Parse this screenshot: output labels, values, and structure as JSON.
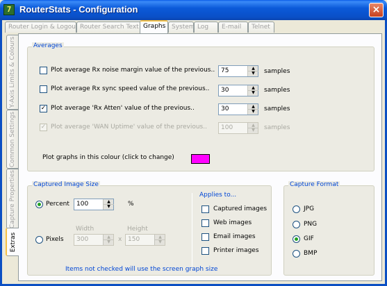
{
  "window": {
    "title": "RouterStats - Configuration",
    "close_glyph": "×",
    "app_icon_glyph": "7"
  },
  "top_tabs": [
    {
      "label": "Router Login & Logout"
    },
    {
      "label": "Router Search Text"
    },
    {
      "label": "Graphs"
    },
    {
      "label": "System"
    },
    {
      "label": "Log"
    },
    {
      "label": "E-mail"
    },
    {
      "label": "Telnet"
    }
  ],
  "side_tabs": [
    {
      "label": "Y-Axis Limits & Colours"
    },
    {
      "label": "Common Settings"
    },
    {
      "label": "Capture Properties"
    },
    {
      "label": "Extras"
    }
  ],
  "averages": {
    "title": "Averages",
    "samples_label": "samples",
    "rows": [
      {
        "label": "Plot average Rx noise margin value of the previous..",
        "checked": false,
        "enabled": true,
        "value": "75"
      },
      {
        "label": "Plot average Rx sync speed value of the previous..",
        "checked": false,
        "enabled": true,
        "value": "30"
      },
      {
        "label": "Plot average 'Rx Atten' value of the previous..",
        "checked": true,
        "enabled": true,
        "value": "30"
      },
      {
        "label": "Plot average 'WAN Uptime' value of the previous..",
        "checked": true,
        "enabled": false,
        "value": "100"
      }
    ],
    "colour_label": "Plot graphs in this colour (click to change)",
    "colour": "#ff00ff"
  },
  "captured_image_size": {
    "title": "Captured Image Size",
    "percent_label": "Percent",
    "percent_value": "100",
    "percent_unit": "%",
    "pixels_label": "Pixels",
    "width_label": "Width",
    "height_label": "Height",
    "width_value": "300",
    "height_value": "150",
    "times_glyph": "x",
    "selected": "percent",
    "applies_title": "Applies to...",
    "applies": [
      {
        "label": "Captured images",
        "checked": false
      },
      {
        "label": "Web images",
        "checked": false
      },
      {
        "label": "Email images",
        "checked": false
      },
      {
        "label": "Printer images",
        "checked": false
      }
    ],
    "note": "Items not checked will use the screen graph size"
  },
  "capture_format": {
    "title": "Capture Format",
    "options": [
      {
        "label": "JPG",
        "selected": false
      },
      {
        "label": "PNG",
        "selected": false
      },
      {
        "label": "GIF",
        "selected": true
      },
      {
        "label": "BMP",
        "selected": false
      }
    ]
  },
  "colors": {
    "accent": "#0046d5",
    "titlebar": "#0a4fc7",
    "tab_highlight": "#f6c143"
  }
}
